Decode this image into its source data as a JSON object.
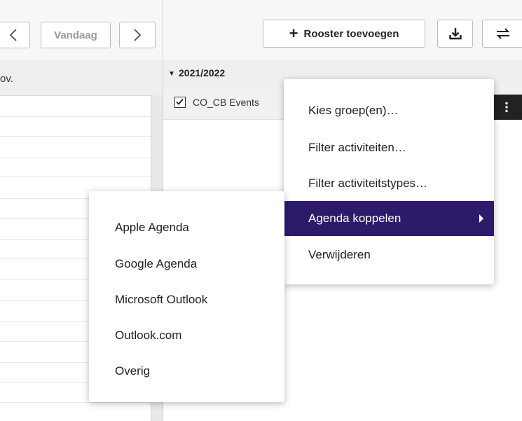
{
  "left_toolbar": {
    "today_label": "Vandaag"
  },
  "left_header": {
    "column_label": "ov."
  },
  "right_toolbar": {
    "add_schedule_label": "Rooster toevoegen"
  },
  "schedule_list": {
    "year_label": "2021/2022",
    "roster_name": "CO_CB Events",
    "roster_checked": true
  },
  "context_menu": {
    "items": [
      {
        "label": "Kies groep(en)…"
      },
      {
        "label": "Filter activiteiten…"
      },
      {
        "label": "Filter activiteitstypes…"
      },
      {
        "label": "Agenda koppelen",
        "active": true,
        "has_submenu": true
      },
      {
        "label": "Verwijderen"
      }
    ]
  },
  "submenu": {
    "items": [
      {
        "label": "Apple Agenda"
      },
      {
        "label": "Google Agenda"
      },
      {
        "label": "Microsoft Outlook"
      },
      {
        "label": "Outlook.com"
      },
      {
        "label": "Overig"
      }
    ]
  },
  "colors": {
    "menu_highlight": "#2d1a6b",
    "toolbar_bg": "#f7f7f7",
    "header_bg": "#efefef"
  },
  "icons": {
    "prev": "chevron-left-icon",
    "next": "chevron-right-icon",
    "add": "plus-icon",
    "download": "download-icon",
    "sync": "swap-arrows-icon",
    "more": "kebab-icon",
    "collapse": "caret-down-icon",
    "submenu": "caret-right-icon"
  }
}
